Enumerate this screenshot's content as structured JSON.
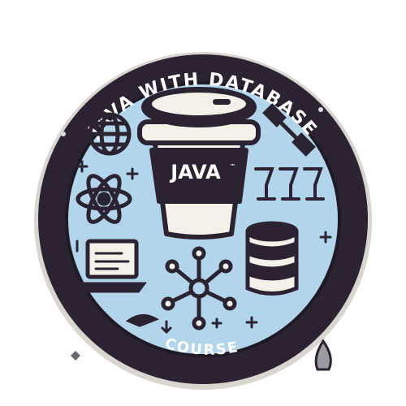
{
  "badge": {
    "top_text": "JAVA WITH DATABASE",
    "bottom_text": "COURSE",
    "cup_label": "JAVA",
    "cup_trademark": "™"
  },
  "colors": {
    "ring": "#2b2331",
    "inner": "#b3d5eb",
    "outline": "#2b2331",
    "cup_white": "#f4f1ea",
    "edge": "#d9d6d0"
  },
  "icons": [
    "coffee-cup-icon",
    "globe-icon",
    "atom-icon",
    "laptop-icon",
    "network-icon",
    "database-icon",
    "dumbbell-icon",
    "goblet-icon",
    "plus-icon",
    "sparkle-icon"
  ]
}
